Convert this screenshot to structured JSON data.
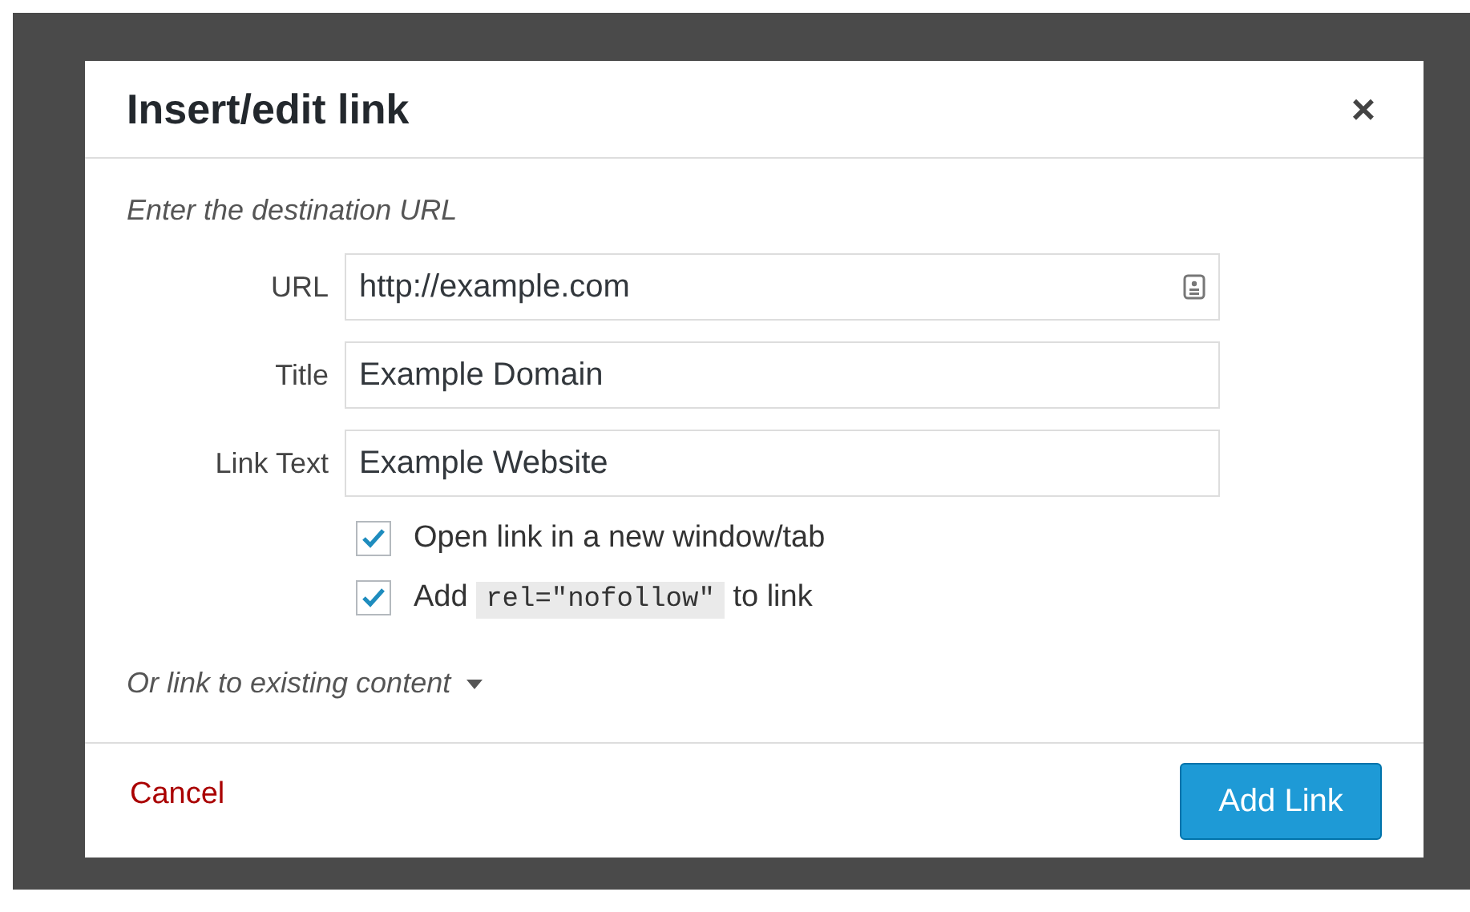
{
  "dialog": {
    "title": "Insert/edit link",
    "close": "×",
    "instruction": "Enter the destination URL",
    "fields": [
      {
        "label": "URL",
        "value": "http://example.com",
        "kind": "url"
      },
      {
        "label": "Title",
        "value": "Example Domain",
        "kind": "text"
      },
      {
        "label": "Link Text",
        "value": "Example Website",
        "kind": "text"
      }
    ],
    "options": [
      {
        "before": "Open link in a new window/tab",
        "checked": true
      },
      {
        "before": "Add",
        "code": "rel=\"nofollow\"",
        "after": "to link",
        "checked": true
      }
    ],
    "existing_content": {
      "label": "Or link to existing content",
      "expanded": false
    },
    "buttons": {
      "cancel": "Cancel",
      "submit": "Add Link"
    }
  }
}
